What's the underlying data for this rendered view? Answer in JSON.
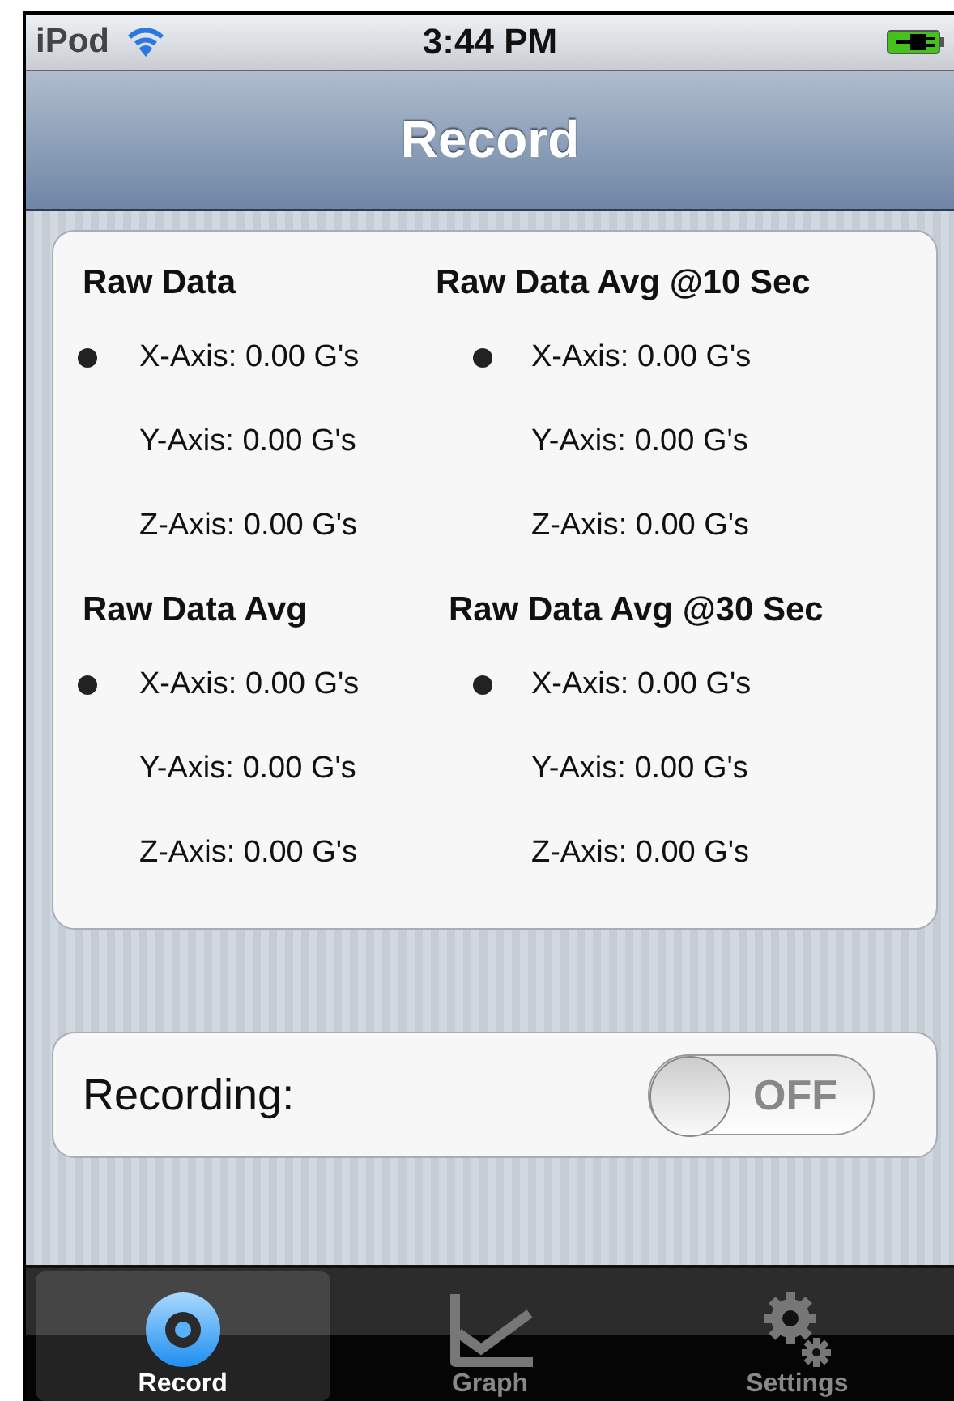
{
  "status_bar": {
    "carrier": "iPod",
    "time": "3:44 PM"
  },
  "nav_bar": {
    "title": "Record"
  },
  "sections": [
    {
      "title": "Raw Data",
      "rows": [
        {
          "text": "X-Axis: 0.00 G's",
          "selected": true
        },
        {
          "text": "Y-Axis: 0.00 G's",
          "selected": false
        },
        {
          "text": "Z-Axis: 0.00 G's",
          "selected": false
        }
      ]
    },
    {
      "title": "Raw Data Avg @10 Sec",
      "rows": [
        {
          "text": "X-Axis: 0.00 G's",
          "selected": true
        },
        {
          "text": "Y-Axis: 0.00 G's",
          "selected": false
        },
        {
          "text": "Z-Axis: 0.00 G's",
          "selected": false
        }
      ]
    },
    {
      "title": "Raw Data Avg",
      "rows": [
        {
          "text": "X-Axis: 0.00 G's",
          "selected": true
        },
        {
          "text": "Y-Axis: 0.00 G's",
          "selected": false
        },
        {
          "text": "Z-Axis: 0.00 G's",
          "selected": false
        }
      ]
    },
    {
      "title": "Raw Data Avg @30 Sec",
      "rows": [
        {
          "text": "X-Axis: 0.00 G's",
          "selected": true
        },
        {
          "text": "Y-Axis: 0.00 G's",
          "selected": false
        },
        {
          "text": "Z-Axis: 0.00 G's",
          "selected": false
        }
      ]
    }
  ],
  "recording": {
    "label": "Recording:",
    "on": false,
    "switch_text": "OFF"
  },
  "tabs": [
    {
      "kind": "record",
      "label": "Record",
      "selected": true
    },
    {
      "kind": "graph",
      "label": "Graph",
      "selected": false
    },
    {
      "kind": "settings",
      "label": "Settings",
      "selected": false
    }
  ]
}
